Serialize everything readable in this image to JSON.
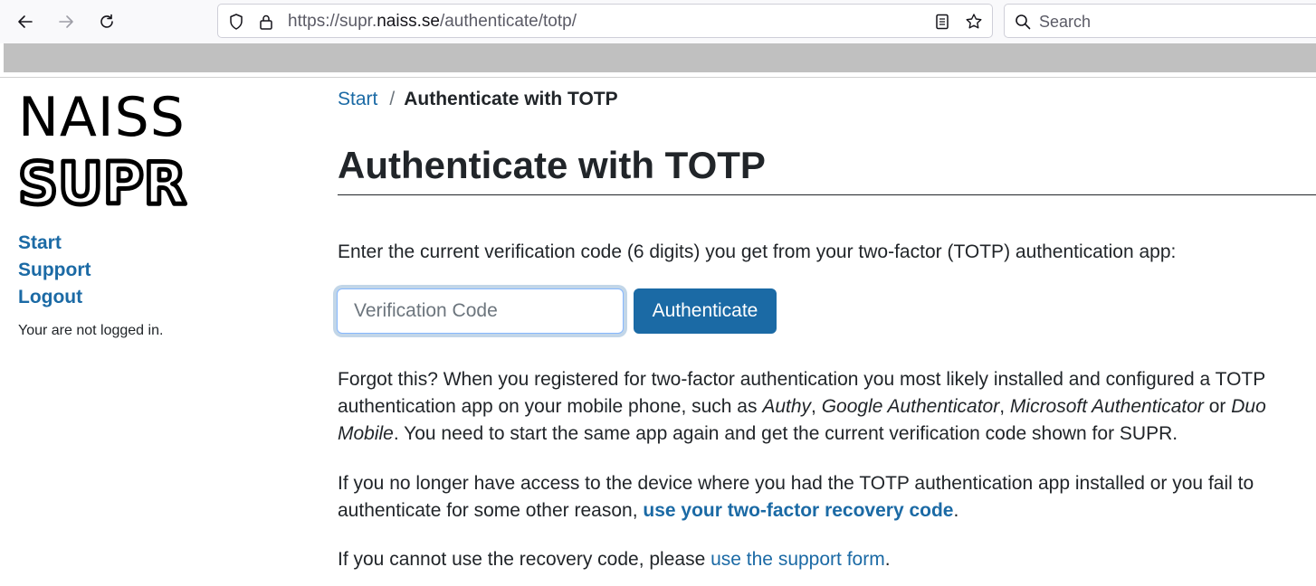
{
  "browser": {
    "url_prefix": "https://supr.",
    "url_domain": "naiss.se",
    "url_path": "/authenticate/totp/",
    "search_placeholder": "Search"
  },
  "sidebar": {
    "logo_top": "NAISS",
    "logo_bottom": "SUPR",
    "nav": [
      {
        "label": "Start"
      },
      {
        "label": "Support"
      },
      {
        "label": "Logout"
      }
    ],
    "status": "Your are not logged in."
  },
  "breadcrumb": {
    "home": "Start",
    "separator": "/",
    "current": "Authenticate with TOTP"
  },
  "main": {
    "title": "Authenticate with TOTP",
    "intro": "Enter the current verification code (6 digits) you get from your two-factor (TOTP) authentication app:",
    "code_placeholder": "Verification Code",
    "authenticate_label": "Authenticate",
    "forgot": {
      "t1": "Forgot this? When you registered for two-factor authentication you most likely installed and configured a TOTP authentication app on your mobile phone, such as ",
      "app1": "Authy",
      "c1": ", ",
      "app2": "Google Authenticator",
      "c2": ", ",
      "app3": "Microsoft Authenticator",
      "or": " or ",
      "app4": "Duo Mobile",
      "t2": ". You need to start the same app again and get the current verification code shown for SUPR."
    },
    "no_access": {
      "t1": "If you no longer have access to the device where you had the TOTP authentication app installed or you fail to authenticate for some other reason, ",
      "link": "use your two-factor recovery code",
      "t2": "."
    },
    "support": {
      "t1": "If you cannot use the recovery code, please ",
      "link": "use the support form",
      "t2": "."
    }
  },
  "colors": {
    "link": "#1b6aa5",
    "button": "#1b6aa5"
  }
}
